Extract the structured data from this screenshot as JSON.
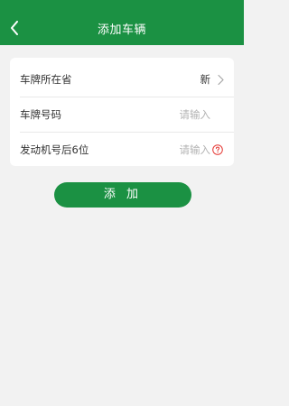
{
  "header": {
    "title": "添加车辆",
    "back_icon": "chevron-left-icon"
  },
  "form": {
    "province": {
      "label": "车牌所在省",
      "value": "新",
      "icon": "chevron-right-icon"
    },
    "plate": {
      "label": "车牌号码",
      "placeholder": "请输入"
    },
    "engine": {
      "label": "发动机号后6位",
      "placeholder": "请输入",
      "icon": "help-icon"
    }
  },
  "actions": {
    "add_label": "添 加"
  },
  "colors": {
    "primary": "#1b9143",
    "help_icon": "#e53935",
    "background": "#f2f2f2"
  }
}
